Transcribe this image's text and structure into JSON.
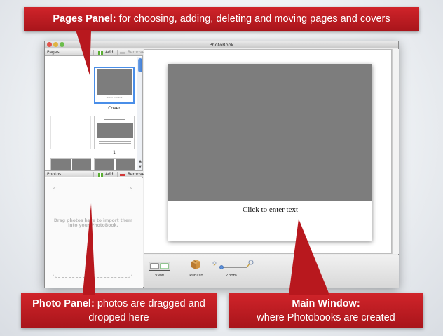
{
  "callouts": {
    "pages": {
      "bold": "Pages Panel:",
      "text": " for choosing, adding, deleting and moving pages and covers"
    },
    "photos": {
      "bold": "Photo Panel:",
      "text": " photos are dragged and dropped here"
    },
    "main": {
      "bold": "Main Window:",
      "text": " where Photobooks are created"
    }
  },
  "window": {
    "title": "PhotoBook"
  },
  "pages_panel": {
    "title": "Pages",
    "add_label": "Add",
    "remove_label": "Remove",
    "cover_label": "Cover",
    "page1_label": "1",
    "cover_caption": "Click to enter text"
  },
  "photos_panel": {
    "title": "Photos",
    "add_label": "Add",
    "remove_label": "Remove",
    "drop_hint": "Drag photos here to import them into your PhotoBook."
  },
  "canvas": {
    "text_placeholder": "Click to enter text"
  },
  "toolbar": {
    "view_label": "View",
    "publish_label": "Publish",
    "zoom_label": "Zoom"
  },
  "colors": {
    "callout": "#c0161d",
    "plus": "#5aae33",
    "minus": "#d23a3a",
    "photo_placeholder": "#7d7d7d",
    "selection": "#4a8ee8"
  },
  "icons": {
    "add": "plus-icon",
    "remove": "minus-icon",
    "view": "view-icon",
    "publish": "package-icon",
    "zoom_out": "small-magnifier-icon",
    "zoom_in": "large-magnifier-icon"
  }
}
